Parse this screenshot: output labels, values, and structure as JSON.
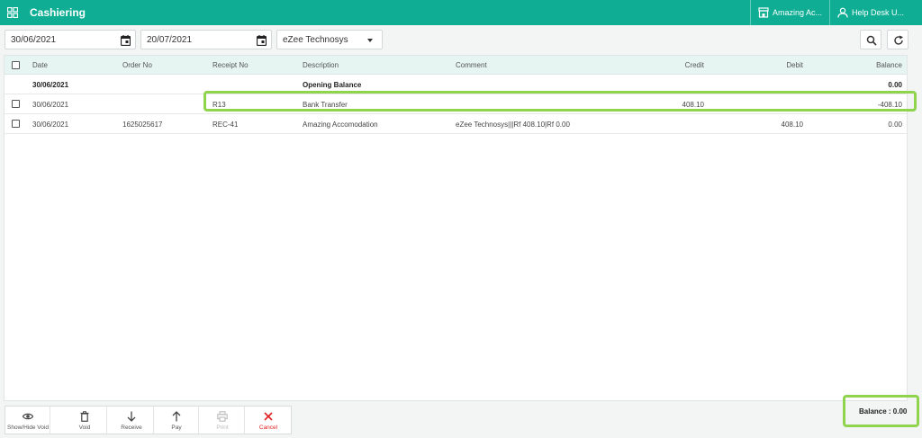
{
  "app": {
    "title": "Cashiering"
  },
  "header": {
    "hotel_name": "Amazing Ac...",
    "user_name": "Help Desk U..."
  },
  "filters": {
    "from_date": "30/06/2021",
    "to_date": "20/07/2021",
    "account": "eZee Technosys"
  },
  "table": {
    "columns": [
      "Date",
      "Order No",
      "Receipt No",
      "Description",
      "Comment",
      "Credit",
      "Debit",
      "Balance"
    ],
    "rows": [
      {
        "date": "30/06/2021",
        "order_no": "",
        "receipt_no": "",
        "description": "Opening Balance",
        "comment": "",
        "credit": "",
        "debit": "",
        "balance": "0.00",
        "bold": true
      },
      {
        "date": "30/06/2021",
        "order_no": "",
        "receipt_no": "R13",
        "description": "Bank Transfer",
        "comment": "",
        "credit": "408.10",
        "debit": "",
        "balance": "-408.10"
      },
      {
        "date": "30/06/2021",
        "order_no": "1625025617",
        "receipt_no": "REC-41",
        "description": "Amazing Accomodation",
        "comment": "eZee Technosys|||Rf 408.10|Rf 0.00",
        "credit": "",
        "debit": "408.10",
        "balance": "0.00"
      }
    ]
  },
  "footer": {
    "show_hide_void": "Show/Hide Void",
    "void": "Void",
    "receive": "Receive",
    "pay": "Pay",
    "print": "Print",
    "cancel": "Cancel",
    "balance": "Balance : 0.00"
  },
  "colors": {
    "header": "#0fae94",
    "highlight": "#8fd44c",
    "cancel": "#e02020",
    "table_header": "#e6f5f1"
  }
}
